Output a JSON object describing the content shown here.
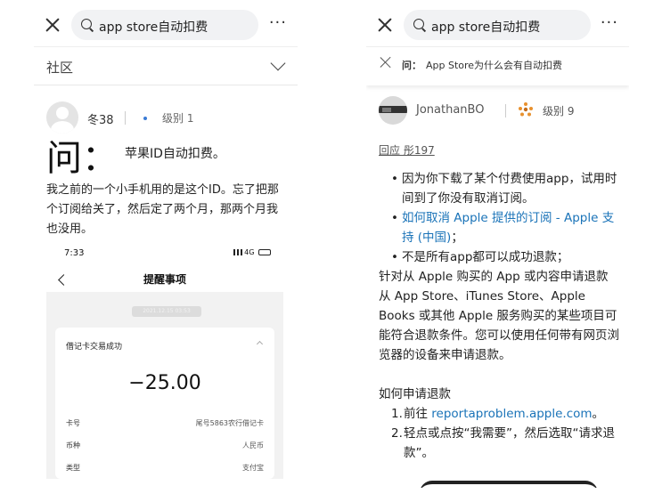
{
  "left": {
    "search_text": "app store自动扣费",
    "more_label": "···",
    "community_label": "社区",
    "user": {
      "name": "冬38",
      "level_label": "级别 1"
    },
    "question_char": "问：",
    "question_title": "苹果ID自动扣费。",
    "question_body": "我之前的一个小手机用的是这个ID。忘了把那个订阅给关了，然后定了两个月，那两个月我也没用。",
    "phone": {
      "time": "7:33",
      "network": "4G",
      "title": "提醒事项",
      "date": "2021.12.15 03:53",
      "card_title": "借记卡交易成功",
      "amount": "−25.00",
      "rows": [
        {
          "label": "卡号",
          "value": "尾号5863农行借记卡"
        },
        {
          "label": "币种",
          "value": "人民币"
        },
        {
          "label": "类型",
          "value": "支付宝"
        }
      ]
    }
  },
  "right": {
    "search_text": "app store自动扣费",
    "more_label": "···",
    "question_label": "问：",
    "question_text": "App Store为什么会有自动扣费",
    "user": {
      "name": "JonathanBO",
      "level_label": "级别 9"
    },
    "reply_label": "回应 彤197",
    "bullets": {
      "b1": "因为你下载了某个付费使用app，试用时间到了你没有取消订阅。",
      "b2_link": "如何取消 Apple 提供的订阅 - Apple 支持 (中国)",
      "b2_suffix": "；",
      "b3": "不是所有app都可以成功退款；"
    },
    "para1": "针对从 Apple 购买的 App 或内容申请退款",
    "para2": "从 App Store、iTunes Store、Apple Books 或其他 Apple 服务购买的某些项目可能符合退款条件。您可以使用任何带有网页浏览器的设备来申请退款。",
    "how_title": "如何申请退款",
    "steps": {
      "s1_num": "1.",
      "s1_prefix": "前往 ",
      "s1_link": "reportaproblem.apple.com",
      "s1_suffix": "。",
      "s2_num": "2.",
      "s2": "轻点或点按“我需要”，然后选取“请求退款”。"
    }
  }
}
